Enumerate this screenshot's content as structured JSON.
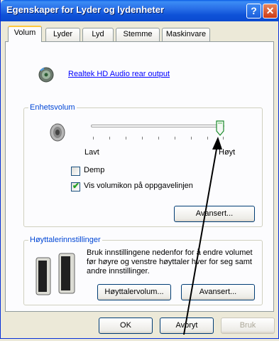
{
  "window": {
    "title": "Egenskaper for Lyder og lydenheter",
    "help_label": "?",
    "close_label": "✕"
  },
  "tabs": [
    {
      "label": "Volum"
    },
    {
      "label": "Lyder"
    },
    {
      "label": "Lyd"
    },
    {
      "label": "Stemme"
    },
    {
      "label": "Maskinvare"
    }
  ],
  "device": {
    "name": "Realtek HD Audio rear output",
    "icon": "speaker-icon"
  },
  "device_volume": {
    "group_title": "Enhetsvolum",
    "slider_min_label": "Lavt",
    "slider_max_label": "Høyt",
    "slider_level": 0.95,
    "mute_label": "Demp",
    "mute_checked": false,
    "show_icon_label": "Vis volumikon på oppgavelinjen",
    "show_icon_checked": true,
    "advanced_label": "Avansert..."
  },
  "speaker_settings": {
    "group_title": "Høyttalerinnstillinger",
    "description": "Bruk innstillingene nedenfor for å endre volumet før høyre og venstre høyttaler hver for seg samt andre innstillinger.",
    "line1": "Bruk innstillingene nedenfor for å endre volumet",
    "line2": "før høyre og venstre høyttaler hver for seg samt",
    "line3": "andre innstillinger.",
    "speaker_volume_label": "Høyttalervolum...",
    "advanced_label": "Avansert..."
  },
  "footer": {
    "ok_label": "OK",
    "cancel_label": "Avbryt",
    "apply_label": "Bruk"
  },
  "colors": {
    "titlebar": "#0a5ce6",
    "group_title": "#0046d5",
    "link": "#0000ff",
    "check": "#21a121"
  }
}
